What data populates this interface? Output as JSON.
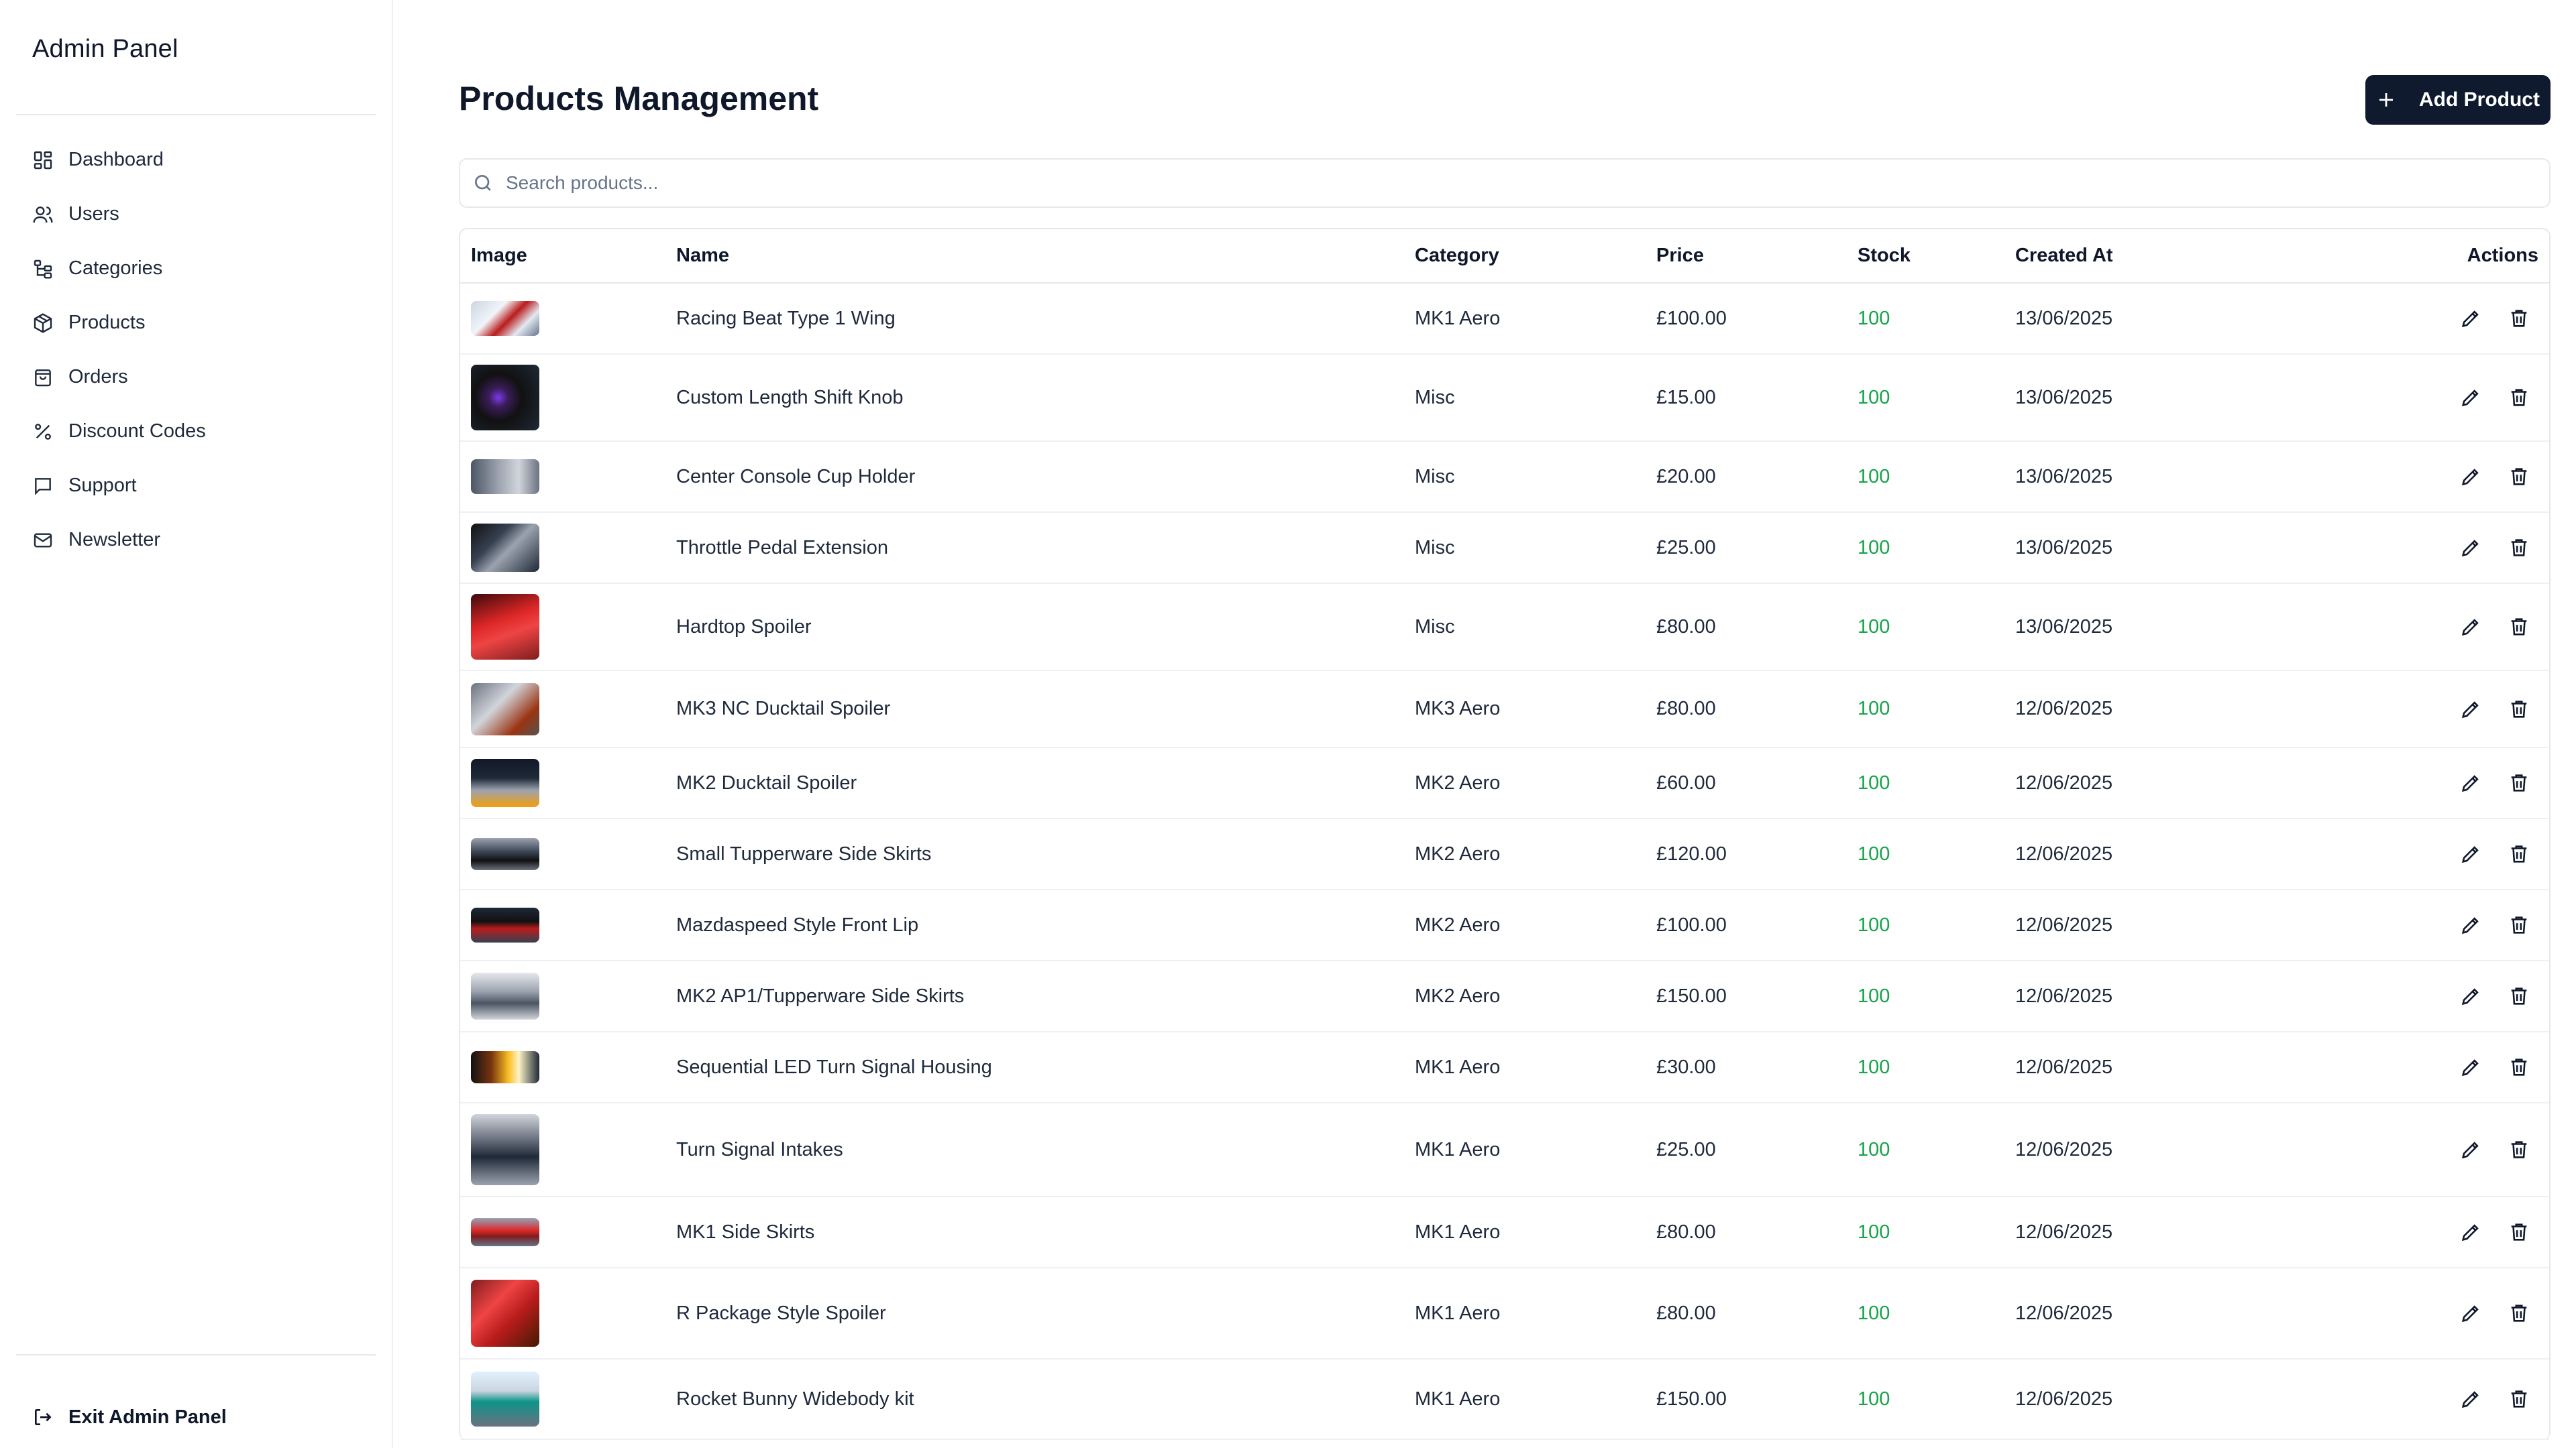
{
  "sidebar": {
    "brand": "Admin Panel",
    "items": [
      {
        "label": "Dashboard",
        "icon": "dashboard-icon"
      },
      {
        "label": "Users",
        "icon": "users-icon"
      },
      {
        "label": "Categories",
        "icon": "categories-icon"
      },
      {
        "label": "Products",
        "icon": "box-icon"
      },
      {
        "label": "Orders",
        "icon": "shopping-bag-icon"
      },
      {
        "label": "Discount Codes",
        "icon": "percent-icon"
      },
      {
        "label": "Support",
        "icon": "message-icon"
      },
      {
        "label": "Newsletter",
        "icon": "mail-icon"
      }
    ],
    "exit_label": "Exit Admin Panel"
  },
  "main": {
    "title": "Products Management",
    "add_button": "Add Product",
    "search_placeholder": "Search products...",
    "columns": [
      "Image",
      "Name",
      "Category",
      "Price",
      "Stock",
      "Created At",
      "Actions"
    ],
    "rows": [
      {
        "name": "Racing Beat Type 1 Wing",
        "category": "MK1 Aero",
        "price": "£100.00",
        "stock": "100",
        "created": "13/06/2025",
        "thumb": "white-car-rear"
      },
      {
        "name": "Custom Length Shift Knob",
        "category": "Misc",
        "price": "£15.00",
        "stock": "100",
        "created": "13/06/2025",
        "thumb": "shift-knob-purple"
      },
      {
        "name": "Center Console Cup Holder",
        "category": "Misc",
        "price": "£20.00",
        "stock": "100",
        "created": "13/06/2025",
        "thumb": "grey-console"
      },
      {
        "name": "Throttle Pedal Extension",
        "category": "Misc",
        "price": "£25.00",
        "stock": "100",
        "created": "13/06/2025",
        "thumb": "pedals"
      },
      {
        "name": "Hardtop Spoiler",
        "category": "Misc",
        "price": "£80.00",
        "stock": "100",
        "created": "13/06/2025",
        "thumb": "red-car"
      },
      {
        "name": "MK3 NC Ducktail Spoiler",
        "category": "MK3 Aero",
        "price": "£80.00",
        "stock": "100",
        "created": "12/06/2025",
        "thumb": "silver-car-brick"
      },
      {
        "name": "MK2 Ducktail Spoiler",
        "category": "MK2 Aero",
        "price": "£60.00",
        "stock": "100",
        "created": "12/06/2025",
        "thumb": "car-night"
      },
      {
        "name": "Small Tupperware Side Skirts",
        "category": "MK2 Aero",
        "price": "£120.00",
        "stock": "100",
        "created": "12/06/2025",
        "thumb": "dark-car"
      },
      {
        "name": "Mazdaspeed Style Front Lip",
        "category": "MK2 Aero",
        "price": "£100.00",
        "stock": "100",
        "created": "12/06/2025",
        "thumb": "red-car-dark"
      },
      {
        "name": "MK2 AP1/Tupperware Side Skirts",
        "category": "MK2 Aero",
        "price": "£150.00",
        "stock": "100",
        "created": "12/06/2025",
        "thumb": "grey-car"
      },
      {
        "name": "Sequential LED Turn Signal Housing",
        "category": "MK1 Aero",
        "price": "£30.00",
        "stock": "100",
        "created": "12/06/2025",
        "thumb": "amber-light"
      },
      {
        "name": "Turn Signal Intakes",
        "category": "MK1 Aero",
        "price": "£25.00",
        "stock": "100",
        "created": "12/06/2025",
        "thumb": "car-front-grey"
      },
      {
        "name": "MK1 Side Skirts",
        "category": "MK1 Aero",
        "price": "£80.00",
        "stock": "100",
        "created": "12/06/2025",
        "thumb": "red-car-side"
      },
      {
        "name": "R Package Style Spoiler",
        "category": "MK1 Aero",
        "price": "£80.00",
        "stock": "100",
        "created": "12/06/2025",
        "thumb": "red-car-close"
      },
      {
        "name": "Rocket Bunny Widebody kit",
        "category": "MK1 Aero",
        "price": "£150.00",
        "stock": "100",
        "created": "12/06/2025",
        "thumb": "teal-car"
      }
    ]
  }
}
